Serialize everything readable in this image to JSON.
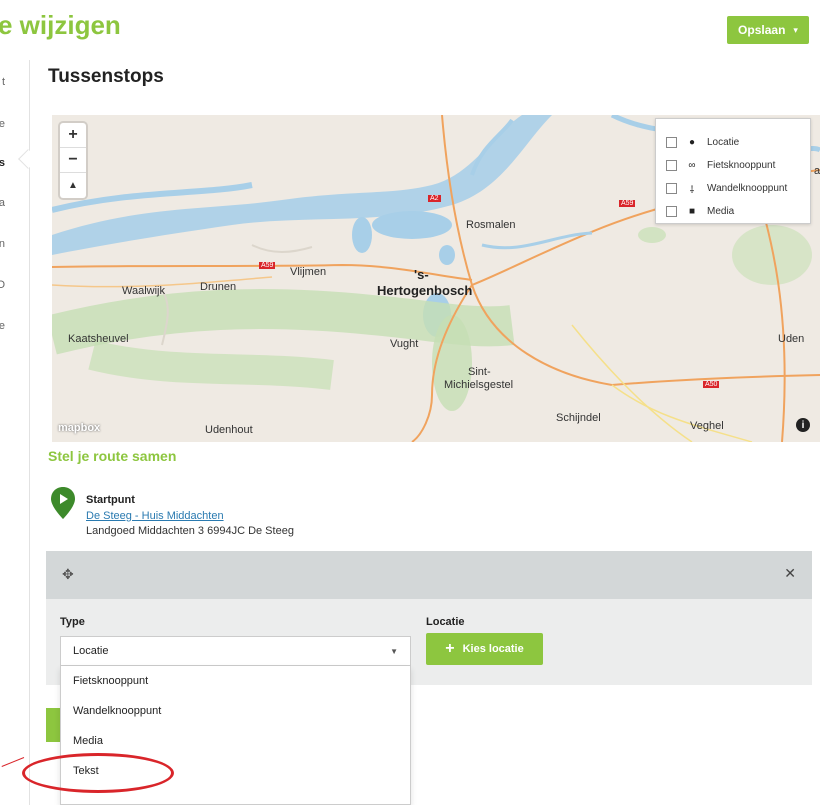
{
  "header": {
    "title": "e wijzigen",
    "save_label": "Opslaan",
    "save_caret": "▾"
  },
  "left_nav": {
    "items": [
      {
        "label": "t"
      },
      {
        "label": "e"
      },
      {
        "label": "s"
      },
      {
        "label": "a"
      },
      {
        "label": "n"
      },
      {
        "label": "O"
      },
      {
        "label": "e"
      }
    ]
  },
  "section": {
    "title": "Tussenstops"
  },
  "map": {
    "zoom_in": "+",
    "zoom_out": "−",
    "compass": "▲",
    "places": {
      "rosmalen": "Rosmalen",
      "s_hertogenbosch_1": "'s-",
      "s_hertogenbosch_2": "Hertogenbosch",
      "vlijmen": "Vlijmen",
      "waalwijk": "Waalwijk",
      "drunen": "Drunen",
      "kaatsheuvel": "Kaatsheuvel",
      "vught": "Vught",
      "sint_1": "Sint-",
      "sint_2": "Michielsgestel",
      "schijndel": "Schijndel",
      "veghel": "Veghel",
      "uden": "Uden",
      "udenhout": "Udenhout",
      "edge": "ai"
    },
    "roads": {
      "a2": "A2",
      "a59_1": "A59",
      "a59_2": "A59",
      "a50": "A50"
    },
    "logo": "mapbox",
    "info": "i",
    "legend": [
      {
        "icon": "location-pin-icon",
        "glyph": "●",
        "label": "Locatie"
      },
      {
        "icon": "bicycle-icon",
        "glyph": "∞",
        "label": "Fietsknooppunt"
      },
      {
        "icon": "walking-icon",
        "glyph": "⸸",
        "label": "Wandelknooppunt"
      },
      {
        "icon": "camera-icon",
        "glyph": "■",
        "label": "Media"
      }
    ]
  },
  "route": {
    "title": "Stel je route samen",
    "start_label": "Startpunt",
    "start_link": "De Steeg - Huis Middachten",
    "start_address": "Landgoed Middachten 3 6994JC De Steeg"
  },
  "stop": {
    "drag_icon": "✥",
    "close_icon": "✕",
    "type_label": "Type",
    "type_value": "Locatie",
    "location_label": "Locatie",
    "kies_label": "Kies locatie",
    "kies_plus": "+",
    "options": [
      "Fietsknooppunt",
      "Wandelknooppunt",
      "Media",
      "Tekst"
    ]
  },
  "colors": {
    "brand_green": "#8dc63f",
    "highlight_red": "#d9252a",
    "link_blue": "#2a7ab0"
  }
}
